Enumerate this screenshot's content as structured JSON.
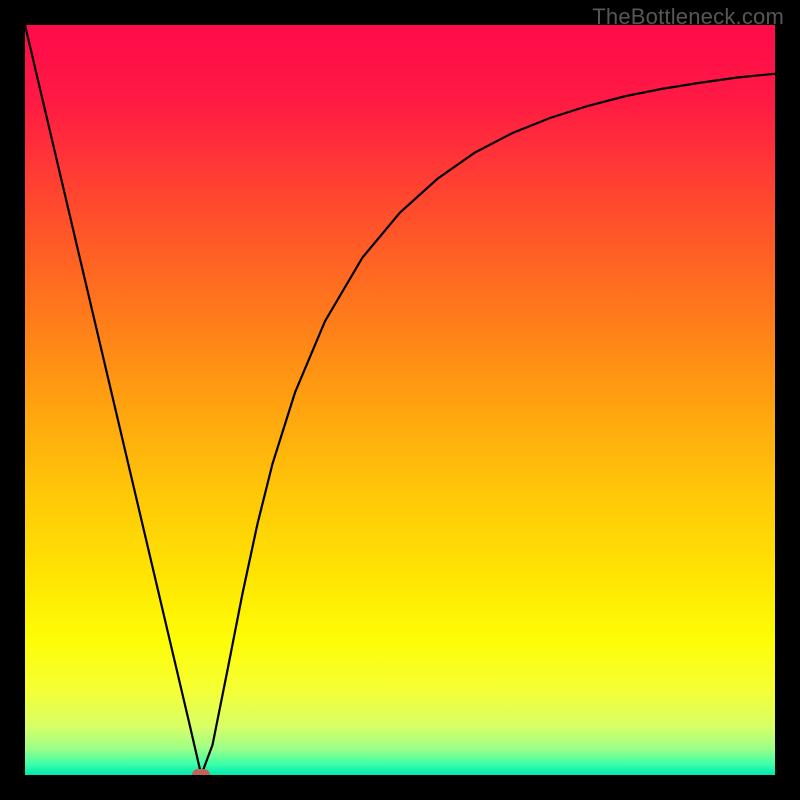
{
  "watermark": "TheBottleneck.com",
  "colors": {
    "frame": "#000000",
    "gradient_stops": [
      {
        "offset": 0.0,
        "color": "#ff0a4a"
      },
      {
        "offset": 0.1,
        "color": "#ff1a44"
      },
      {
        "offset": 0.22,
        "color": "#ff4330"
      },
      {
        "offset": 0.35,
        "color": "#ff6e1f"
      },
      {
        "offset": 0.5,
        "color": "#ffa010"
      },
      {
        "offset": 0.62,
        "color": "#ffc608"
      },
      {
        "offset": 0.74,
        "color": "#ffe603"
      },
      {
        "offset": 0.82,
        "color": "#fdfd06"
      },
      {
        "offset": 0.885,
        "color": "#f6ff33"
      },
      {
        "offset": 0.935,
        "color": "#d8ff66"
      },
      {
        "offset": 0.965,
        "color": "#9cff88"
      },
      {
        "offset": 0.985,
        "color": "#3effa8"
      },
      {
        "offset": 1.0,
        "color": "#00e8b0"
      }
    ],
    "curve": "#000000",
    "marker": "#c16357"
  },
  "chart_data": {
    "type": "line",
    "title": "",
    "xlabel": "",
    "ylabel": "",
    "xlim": [
      0,
      100
    ],
    "ylim": [
      0,
      100
    ],
    "x": [
      0,
      2,
      4,
      6,
      8,
      10,
      12,
      14,
      16,
      18,
      20,
      22,
      23.5,
      25,
      27,
      29,
      31,
      33,
      36,
      40,
      45,
      50,
      55,
      60,
      65,
      70,
      75,
      80,
      85,
      90,
      95,
      100
    ],
    "values": [
      100,
      91.5,
      83,
      74.5,
      66,
      57.5,
      49,
      40.5,
      32,
      23.5,
      15,
      6.5,
      0,
      4,
      14,
      24.2,
      33.5,
      41.5,
      51,
      60.5,
      69,
      75,
      79.5,
      83,
      85.6,
      87.6,
      89.2,
      90.5,
      91.5,
      92.3,
      93,
      93.5
    ],
    "marker": {
      "x": 23.5,
      "y": 0
    }
  }
}
